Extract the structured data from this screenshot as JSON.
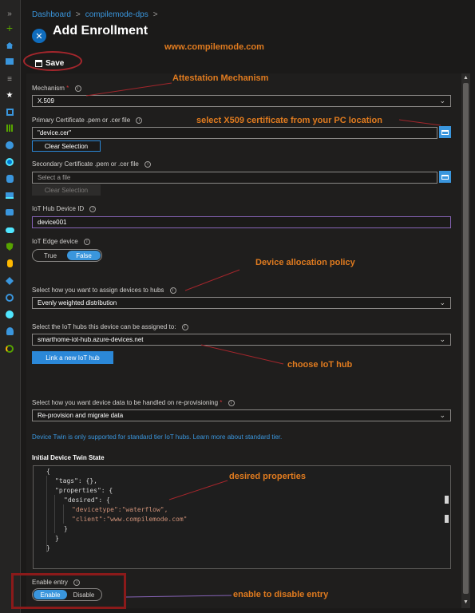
{
  "breadcrumb": {
    "home": "Dashboard",
    "separator": ">",
    "current": "compilemode-dps",
    "trail_end": ">"
  },
  "page": {
    "title": "Add Enrollment"
  },
  "toolbar": {
    "save_label": "Save"
  },
  "annotations": {
    "site": "www.compilemode.com",
    "attestation": "Attestation Mechanism",
    "select_cert": "select X509 certificate from your PC location",
    "allocation": "Device allocation policy",
    "choose_hub": "choose IoT hub",
    "desired": "desired properties",
    "enable_entry": "enable to disable entry"
  },
  "form": {
    "mechanism": {
      "label": "Mechanism",
      "required_mark": "*",
      "value": "X.509"
    },
    "primary_cert": {
      "label": "Primary Certificate .pem or .cer file",
      "value": "\"device.cer\"",
      "clear_label": "Clear Selection"
    },
    "secondary_cert": {
      "label": "Secondary Certificate .pem or .cer file",
      "placeholder": "Select a file",
      "clear_label": "Clear Selection"
    },
    "device_id": {
      "label": "IoT Hub Device ID",
      "value": "device001"
    },
    "iot_edge": {
      "label": "IoT Edge device",
      "true_label": "True",
      "false_label": "False",
      "selected": "False"
    },
    "assign": {
      "label": "Select how you want to assign devices to hubs",
      "value": "Evenly weighted distribution"
    },
    "hubs": {
      "label": "Select the IoT hubs this device can be assigned to:",
      "value": "smarthome-iot-hub.azure-devices.net",
      "link_button": "Link a new IoT hub"
    },
    "reprovision": {
      "label": "Select how you want device data to be handled on re-provisioning",
      "required_mark": "*",
      "value": "Re-provision and migrate data"
    },
    "twin_notice": "Device Twin is only supported for standard tier IoT hubs. Learn more about standard tier.",
    "twin": {
      "label": "Initial Device Twin State",
      "lines": [
        "{",
        "\"tags\": {},",
        "\"properties\": {",
        "\"desired\": {",
        "\"devicetype\":\"waterflow\",",
        "\"client\":\"www.compilemode.com\"",
        "}",
        "}",
        "}"
      ]
    },
    "enable_entry": {
      "label": "Enable entry",
      "enable_label": "Enable",
      "disable_label": "Disable",
      "selected": "Enable"
    }
  },
  "colors": {
    "accent": "#3a96dd",
    "annotation": "#e07b1f",
    "highlight_box": "#8b1a1a",
    "background": "#1b1a19"
  }
}
